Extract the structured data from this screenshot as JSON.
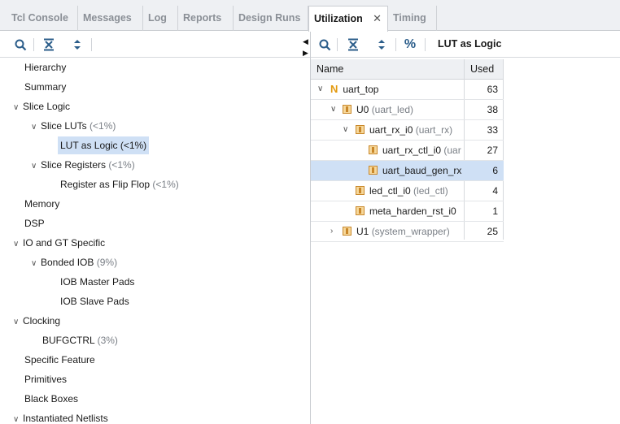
{
  "tabs": [
    {
      "label": "Tcl Console"
    },
    {
      "label": "Messages"
    },
    {
      "label": "Log"
    },
    {
      "label": "Reports"
    },
    {
      "label": "Design Runs"
    },
    {
      "label": "Utilization",
      "active": true
    },
    {
      "label": "Timing"
    }
  ],
  "left_toolbar": {
    "icons": [
      "search-icon",
      "collapse-all-icon",
      "expand-all-icon"
    ]
  },
  "left_tree": [
    {
      "label": "Hierarchy",
      "pct": ""
    },
    {
      "label": "Summary",
      "pct": ""
    },
    {
      "label": "Slice Logic",
      "pct": "",
      "expanded": true
    },
    {
      "label": "Slice LUTs",
      "pct": "(<1%)",
      "expanded": true
    },
    {
      "label": "LUT as Logic",
      "pct": "(<1%)",
      "selected": true
    },
    {
      "label": "Slice Registers",
      "pct": "(<1%)",
      "expanded": true
    },
    {
      "label": "Register as Flip Flop",
      "pct": "(<1%)"
    },
    {
      "label": "Memory",
      "pct": ""
    },
    {
      "label": "DSP",
      "pct": ""
    },
    {
      "label": "IO and GT Specific",
      "pct": "",
      "expanded": true
    },
    {
      "label": "Bonded IOB",
      "pct": "(9%)",
      "expanded": true
    },
    {
      "label": "IOB Master Pads",
      "pct": ""
    },
    {
      "label": "IOB Slave Pads",
      "pct": ""
    },
    {
      "label": "Clocking",
      "pct": "",
      "expanded": true
    },
    {
      "label": "BUFGCTRL",
      "pct": "(3%)"
    },
    {
      "label": "Specific Feature",
      "pct": ""
    },
    {
      "label": "Primitives",
      "pct": ""
    },
    {
      "label": "Black Boxes",
      "pct": ""
    },
    {
      "label": "Instantiated Netlists",
      "pct": "",
      "expanded": true
    }
  ],
  "right_toolbar": {
    "icons": [
      "search-icon",
      "collapse-all-icon",
      "expand-all-icon",
      "percent-icon"
    ],
    "percent_label": "%",
    "title": "LUT as Logic"
  },
  "hier_table": {
    "columns": [
      "Name",
      "Used"
    ],
    "rows": [
      {
        "name": "uart_top",
        "inst": "",
        "used": "63",
        "icon": "top-module-icon",
        "expanded": true
      },
      {
        "name": "U0",
        "inst": "(uart_led)",
        "used": "38",
        "icon": "cell-icon",
        "expanded": true
      },
      {
        "name": "uart_rx_i0",
        "inst": "(uart_rx)",
        "used": "33",
        "icon": "cell-icon",
        "expanded": true
      },
      {
        "name": "uart_rx_ctl_i0",
        "inst": "(uar",
        "used": "27",
        "icon": "cell-icon"
      },
      {
        "name": "uart_baud_gen_rx",
        "inst": "",
        "used": "6",
        "icon": "cell-icon",
        "selected": true
      },
      {
        "name": "led_ctl_i0",
        "inst": "(led_ctl)",
        "used": "4",
        "icon": "cell-icon"
      },
      {
        "name": "meta_harden_rst_i0",
        "inst": "",
        "used": "1",
        "icon": "cell-icon"
      },
      {
        "name": "U1",
        "inst": "(system_wrapper)",
        "used": "25",
        "icon": "cell-icon",
        "expanded": false
      }
    ]
  }
}
